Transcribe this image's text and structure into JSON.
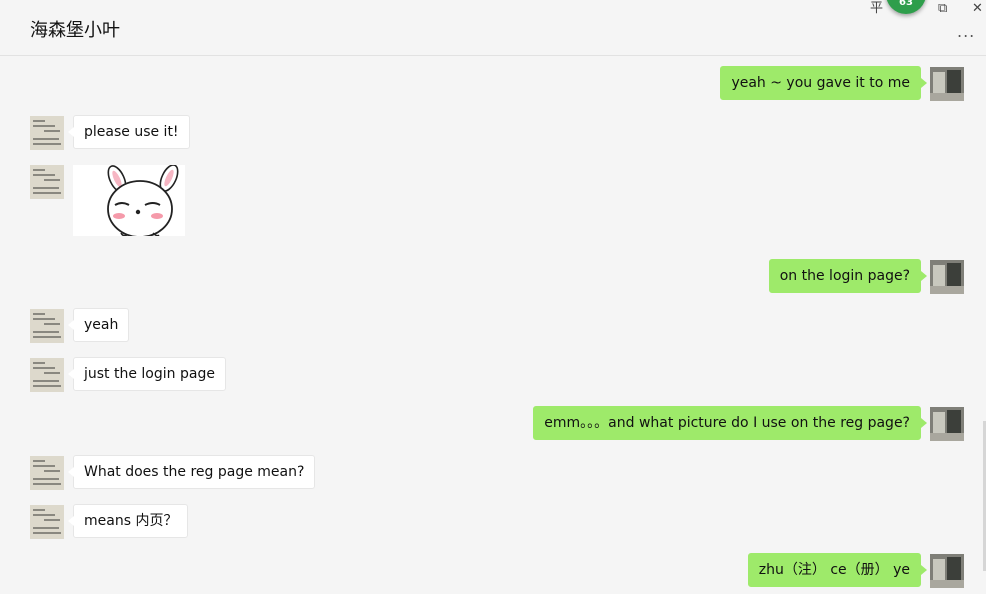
{
  "window": {
    "title": "海森堡小叶",
    "more_label": "...",
    "pin_label": "平",
    "restore_label": "⧉",
    "close_label": "✕",
    "badge_count": "63"
  },
  "messages": [
    {
      "from": "self",
      "text": "yeah ~ you gave it to me"
    },
    {
      "from": "other",
      "text": "please use it!"
    },
    {
      "from": "other",
      "type": "sticker",
      "sticker": "bunny-sticker"
    },
    {
      "from": "self",
      "text": "on the login page?"
    },
    {
      "from": "other",
      "text": "yeah"
    },
    {
      "from": "other",
      "text": "just the login page"
    },
    {
      "from": "self",
      "text": "emm。。。and what picture do I use on the reg page?"
    },
    {
      "from": "other",
      "text": "What does the reg page mean?"
    },
    {
      "from": "other",
      "text": "means 内页？"
    },
    {
      "from": "self",
      "text": "zhu（注） ce（册） ye"
    }
  ],
  "colors": {
    "self_bubble": "#9eea6a",
    "other_bubble": "#ffffff",
    "background": "#f5f5f5",
    "badge": "#2e9e4b"
  }
}
